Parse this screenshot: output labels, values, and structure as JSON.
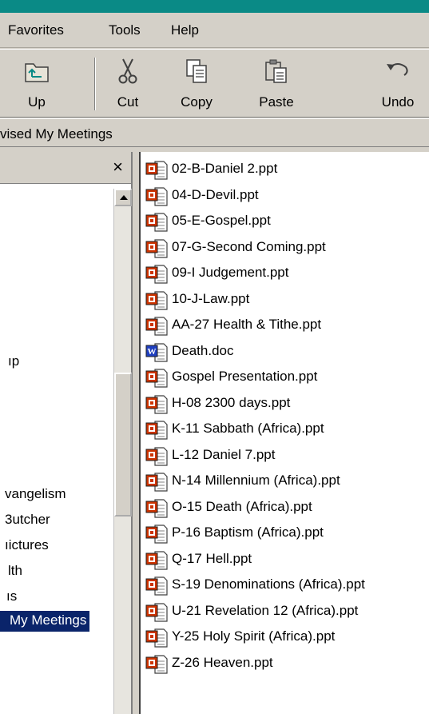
{
  "menu": {
    "favorites": "Favorites",
    "tools": "Tools",
    "help": "Help"
  },
  "toolbar": {
    "up": "Up",
    "cut": "Cut",
    "copy": "Copy",
    "paste": "Paste",
    "undo": "Undo"
  },
  "address": "vised My Meetings",
  "left_pane": {
    "close_glyph": "×",
    "items": [
      "ıp",
      "vangelism",
      "3utcher",
      "ıictures",
      "lth",
      "ıs",
      "My Meetings"
    ]
  },
  "files": [
    {
      "name": "02-B-Daniel 2.ppt",
      "type": "ppt"
    },
    {
      "name": "04-D-Devil.ppt",
      "type": "ppt"
    },
    {
      "name": "05-E-Gospel.ppt",
      "type": "ppt"
    },
    {
      "name": "07-G-Second Coming.ppt",
      "type": "ppt"
    },
    {
      "name": "09-I Judgement.ppt",
      "type": "ppt"
    },
    {
      "name": "10-J-Law.ppt",
      "type": "ppt"
    },
    {
      "name": "AA-27 Health & Tithe.ppt",
      "type": "ppt"
    },
    {
      "name": "Death.doc",
      "type": "doc"
    },
    {
      "name": "Gospel Presentation.ppt",
      "type": "ppt"
    },
    {
      "name": "H-08 2300 days.ppt",
      "type": "ppt"
    },
    {
      "name": "K-11 Sabbath (Africa).ppt",
      "type": "ppt"
    },
    {
      "name": "L-12 Daniel 7.ppt",
      "type": "ppt"
    },
    {
      "name": "N-14 Millennium (Africa).ppt",
      "type": "ppt"
    },
    {
      "name": "O-15 Death (Africa).ppt",
      "type": "ppt"
    },
    {
      "name": "P-16 Baptism (Africa).ppt",
      "type": "ppt"
    },
    {
      "name": "Q-17 Hell.ppt",
      "type": "ppt"
    },
    {
      "name": "S-19 Denominations (Africa).ppt",
      "type": "ppt"
    },
    {
      "name": "U-21 Revelation 12 (Africa).ppt",
      "type": "ppt"
    },
    {
      "name": "Y-25 Holy Spirit (Africa).ppt",
      "type": "ppt"
    },
    {
      "name": "Z-26 Heaven.ppt",
      "type": "ppt"
    }
  ],
  "colors": {
    "title_teal": "#0a8a86",
    "selection": "#0a246a",
    "ppt_red": "#cc3300",
    "doc_blue": "#1f3fbf"
  }
}
